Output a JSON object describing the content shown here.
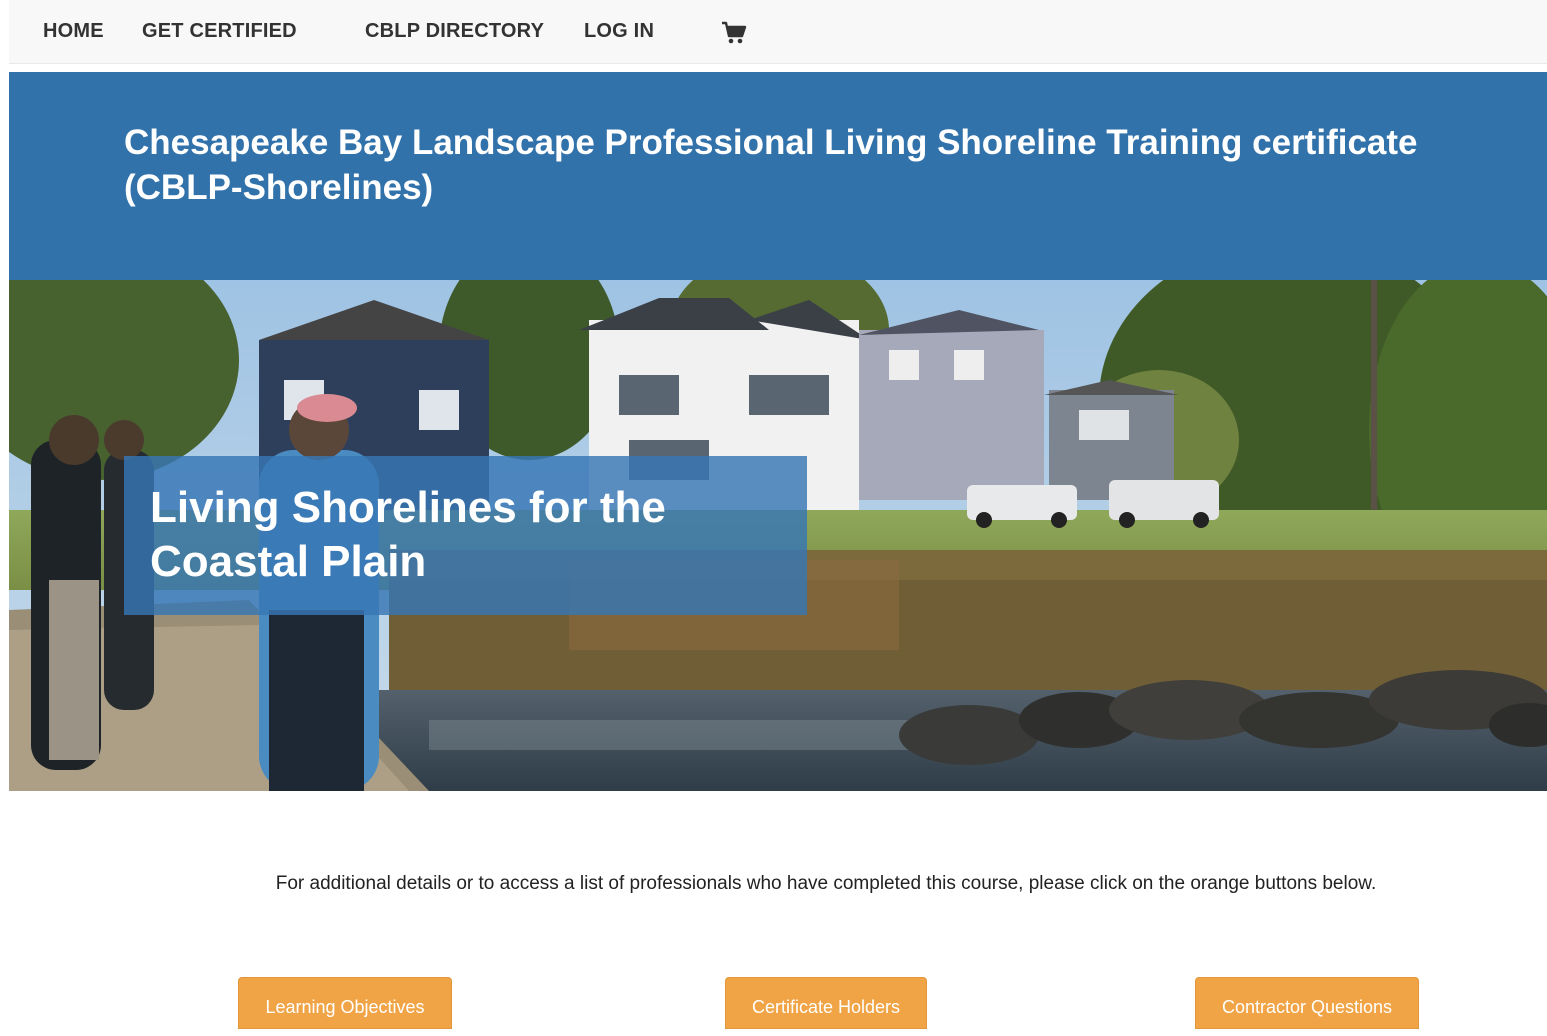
{
  "nav": {
    "items": [
      {
        "label": "HOME"
      },
      {
        "label": "GET CERTIFIED"
      },
      {
        "label": "CBLP DIRECTORY"
      },
      {
        "label": "LOG IN"
      }
    ],
    "cart_icon": "shopping-cart-icon"
  },
  "banner": {
    "title": "Chesapeake Bay Landscape Professional Living Shoreline Training certificate (CBLP-Shorelines)"
  },
  "hero": {
    "title": "Living Shorelines for the Coastal Plain"
  },
  "info": {
    "text": "For additional details or to access a list of professionals who have completed this course, please click on the orange buttons below."
  },
  "buttons": {
    "learning_objectives": "Learning Objectives",
    "certificate_holders": "Certificate Holders",
    "contractor_questions": "Contractor Questions"
  },
  "colors": {
    "banner_blue": "#3272ab",
    "button_orange": "#f0a445",
    "nav_bg": "#f8f8f8"
  }
}
